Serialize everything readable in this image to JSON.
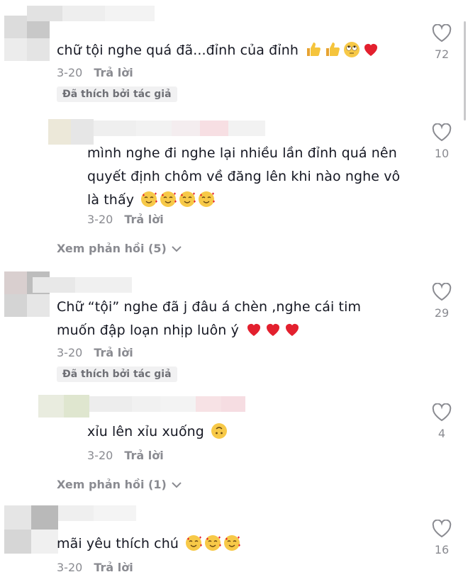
{
  "comments": [
    {
      "text": "chữ tội nghe quá đã...đỉnh của đỉnh",
      "emojis": [
        "thumbs-up",
        "thumbs-up",
        "rolling-eyes",
        "red-heart"
      ],
      "date": "3-20",
      "reply_label": "Trả lời",
      "liked_by_author": "Đã thích bởi tác giả",
      "likes": "72"
    },
    {
      "text": "mình nghe đi nghe lại nhiều lần đỉnh quá nên quyết định chôm về đăng lên khi nào nghe vô là thấy",
      "emojis": [
        "smiling-face-with-hearts",
        "smiling-face-with-hearts",
        "smiling-face-with-hearts",
        "smiling-face-with-hearts"
      ],
      "date": "3-20",
      "reply_label": "Trả lời",
      "likes": "10"
    },
    {
      "view_replies": "Xem phản hồi (5)"
    },
    {
      "text": "Chữ “tội” nghe đã j đâu á chèn ,nghe cái tim muốn đập loạn nhịp luôn ý",
      "emojis": [
        "red-heart",
        "red-heart",
        "red-heart"
      ],
      "date": "3-20",
      "reply_label": "Trả lời",
      "liked_by_author": "Đã thích bởi tác giả",
      "likes": "29"
    },
    {
      "text": "xỉu lên xỉu xuống",
      "emojis": [
        "upside-down-face"
      ],
      "date": "3-20",
      "reply_label": "Trả lời",
      "likes": "4"
    },
    {
      "view_replies": "Xem phản hồi (1)"
    },
    {
      "text": "mãi yêu thích chú",
      "emojis": [
        "smiling-face-with-hearts",
        "smiling-face-with-hearts",
        "smiling-face-with-hearts"
      ],
      "date": "3-20",
      "reply_label": "Trả lời",
      "likes": "16"
    }
  ],
  "colors": {
    "text": "#161823",
    "secondary": "#8a8b91",
    "badge_bg": "#f1f1f2",
    "heart_emoji": "#e3202e"
  }
}
